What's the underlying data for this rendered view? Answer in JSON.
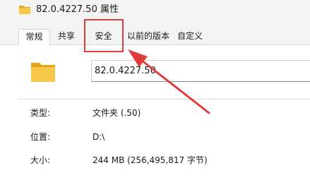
{
  "window": {
    "title": "82.0.4227.50 属性"
  },
  "tabs": [
    {
      "label": "常规",
      "active": true
    },
    {
      "label": "共享",
      "active": false
    },
    {
      "label": "安全",
      "active": false
    },
    {
      "label": "以前的版本",
      "active": false
    },
    {
      "label": "自定义",
      "active": false
    }
  ],
  "general": {
    "folder_name": "82.0.4227.50",
    "properties": [
      {
        "label": "类型:",
        "value": "文件夹 (.50)"
      },
      {
        "label": "位置:",
        "value": "D:\\"
      },
      {
        "label": "大小:",
        "value": "244 MB (256,495,817 字节)"
      }
    ]
  },
  "annotation": {
    "highlight_color": "#e03c3c",
    "highlighted_tab": "安全"
  },
  "icons": {
    "title_icon": "folder-icon",
    "item_icon": "folder-icon"
  },
  "colors": {
    "folder_yellow": "#f5c84a",
    "tab_strip_bg": "#f3f3f3"
  }
}
